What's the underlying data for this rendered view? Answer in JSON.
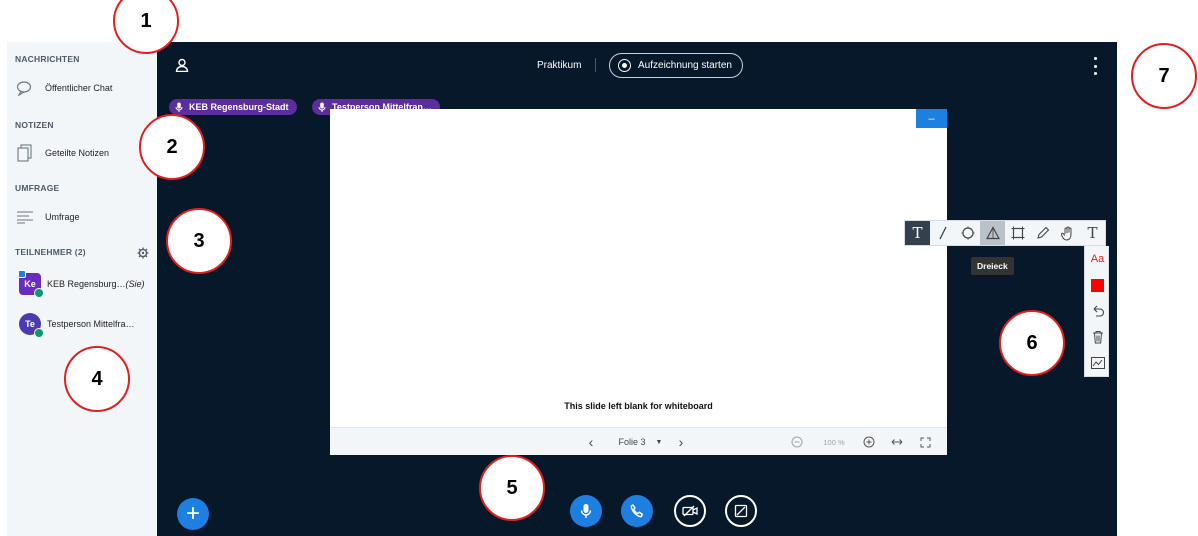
{
  "sidebar": {
    "sections": {
      "messages": "NACHRICHTEN",
      "notes": "NOTIZEN",
      "poll": "UMFRAGE",
      "participants": "TEILNEHMER (2)"
    },
    "public_chat": "Öffentlicher Chat",
    "shared_notes": "Geteilte Notizen",
    "poll_item": "Umfrage",
    "users": [
      {
        "initials": "Ke",
        "name": "KEB Regensburg…",
        "suffix": "(Sie)"
      },
      {
        "initials": "Te",
        "name": "Testperson Mittelfra…",
        "suffix": ""
      }
    ]
  },
  "header": {
    "meeting_title": "Praktikum",
    "record_label": "Aufzeichnung starten"
  },
  "talkers": [
    "KEB Regensburg-Stadt",
    "Testperson Mittelfran…"
  ],
  "slide": {
    "text": "This slide left blank for whiteboard",
    "minimize": "–",
    "page_label": "Folie 3",
    "zoom": "100 %"
  },
  "annotation": {
    "tooltip": "Dreieck",
    "text_tool": "T",
    "color_tool": "Aa"
  },
  "colors": {
    "brand_blue": "#1d7fe0",
    "dark_bg": "#07182a",
    "callout_red": "#e02020",
    "talker_purple": "#5b2d9d",
    "mic_green": "#0a9a6c"
  },
  "callouts": [
    "1",
    "2",
    "3",
    "4",
    "5",
    "6",
    "7"
  ]
}
